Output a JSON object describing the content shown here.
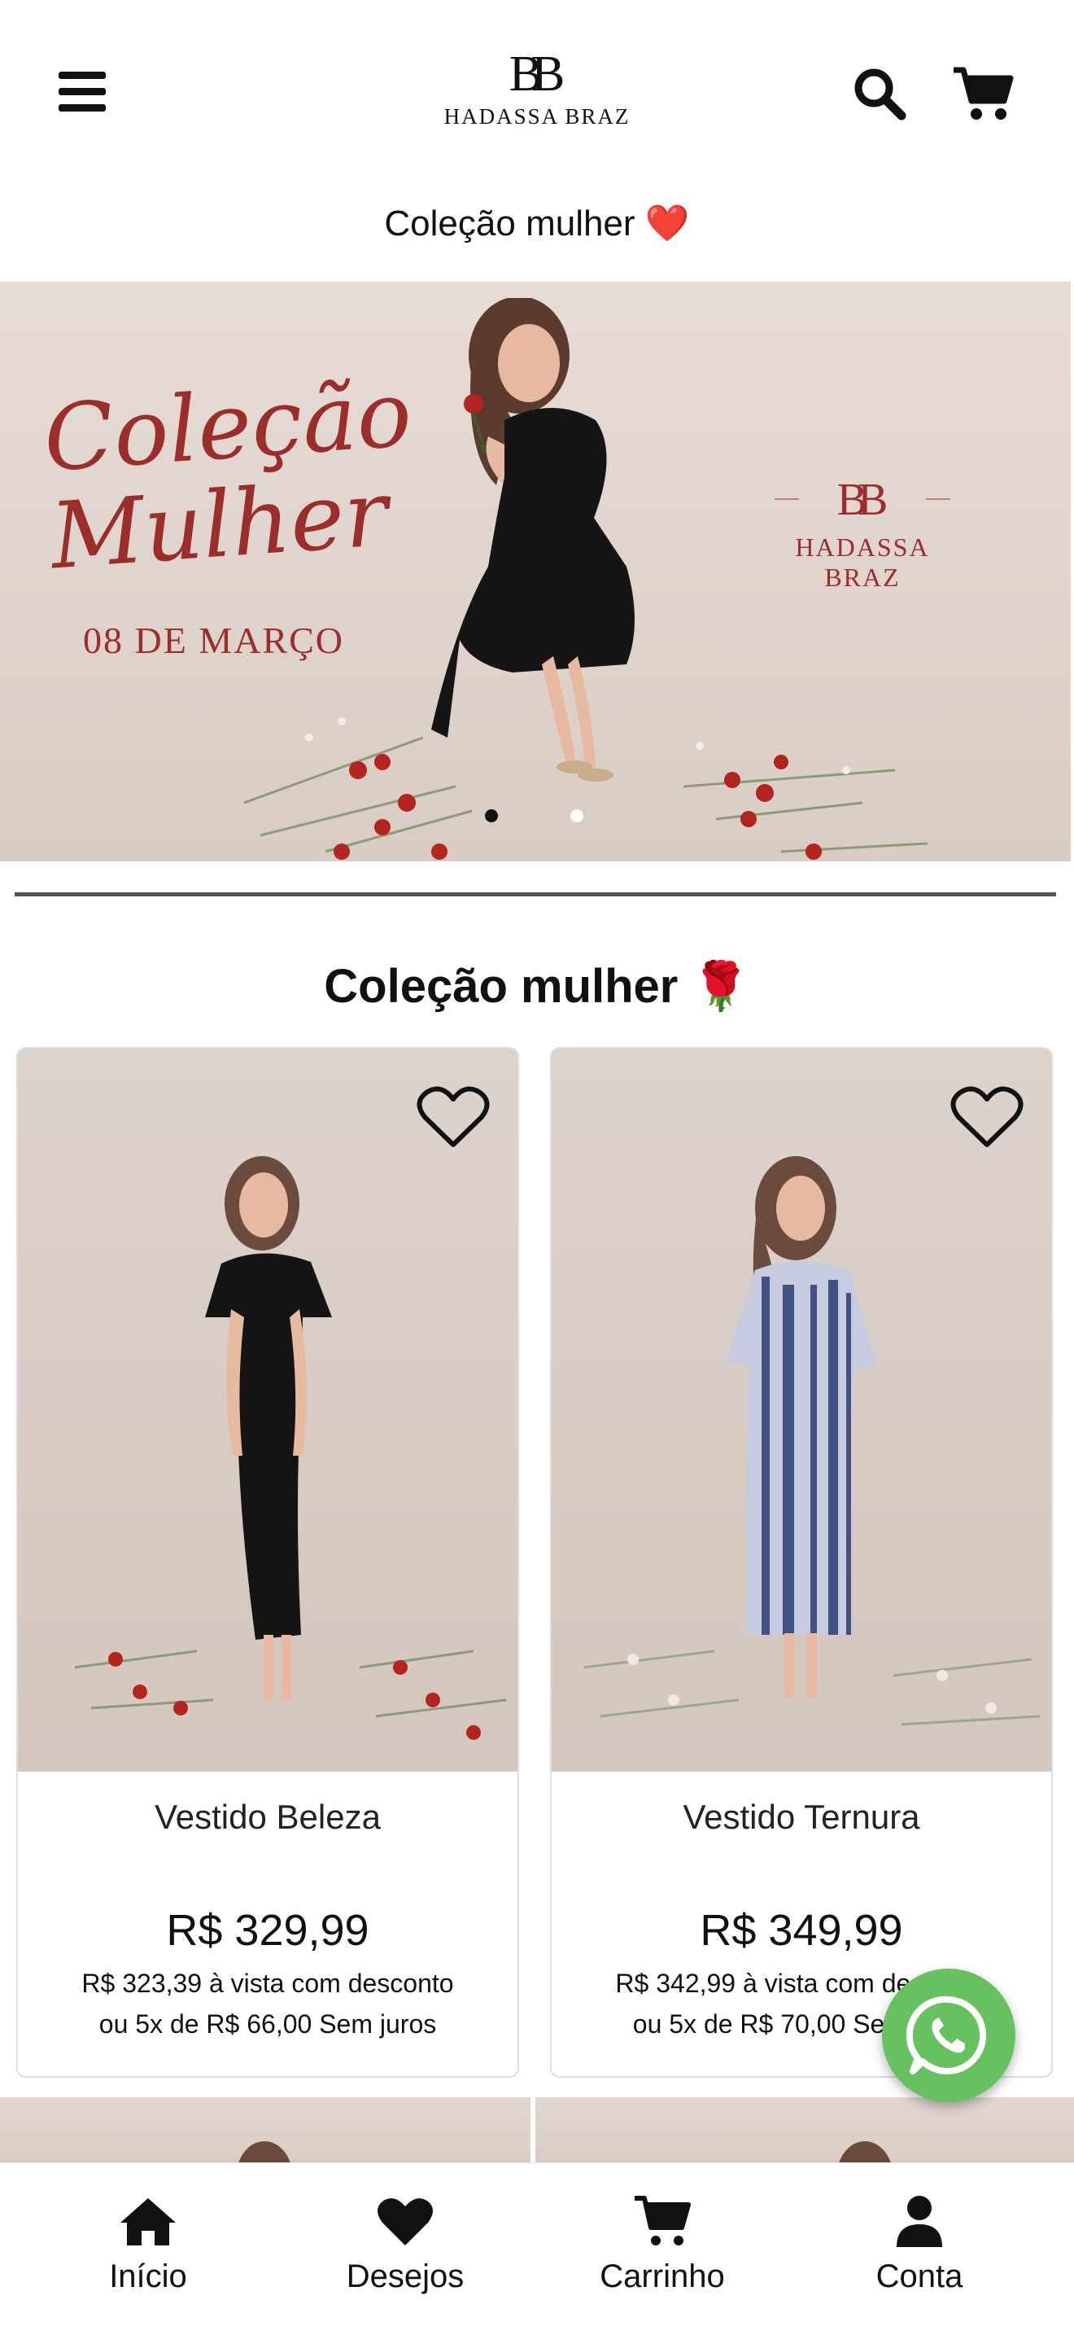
{
  "header": {
    "brand_mark": "BB",
    "brand_name": "HADASSA BRAZ",
    "menu_icon": "hamburger-menu-icon",
    "search_icon": "search-icon",
    "cart_icon": "cart-icon"
  },
  "collection_bar": {
    "text": "Coleção mulher ❤️"
  },
  "hero": {
    "script_line1": "Coleção",
    "script_line2": "Mulher",
    "date": "08 DE MARÇO",
    "brand_mark": "BB",
    "brand_name": "HADASSA BRAZ",
    "slides": 2,
    "active_slide": 1,
    "accent_color": "#9b2d2a"
  },
  "section": {
    "title": "Coleção mulher 🌹",
    "products": [
      {
        "name": "Vestido Beleza",
        "price": "R$ 329,99",
        "cash_price": "R$ 323,39 à vista com desconto",
        "installments": "ou 5x de R$ 66,00 Sem juros"
      },
      {
        "name": "Vestido Ternura",
        "price": "R$ 349,99",
        "cash_price": "R$ 342,99 à vista com desconto",
        "installments": "ou 5x de R$ 70,00 Sem juros"
      }
    ]
  },
  "whatsapp": {
    "icon": "whatsapp-icon",
    "color": "#67c15e"
  },
  "bottom_nav": {
    "items": [
      {
        "label": "Início",
        "icon": "home-icon"
      },
      {
        "label": "Desejos",
        "icon": "heart-icon"
      },
      {
        "label": "Carrinho",
        "icon": "cart-icon"
      },
      {
        "label": "Conta",
        "icon": "user-icon"
      }
    ]
  }
}
